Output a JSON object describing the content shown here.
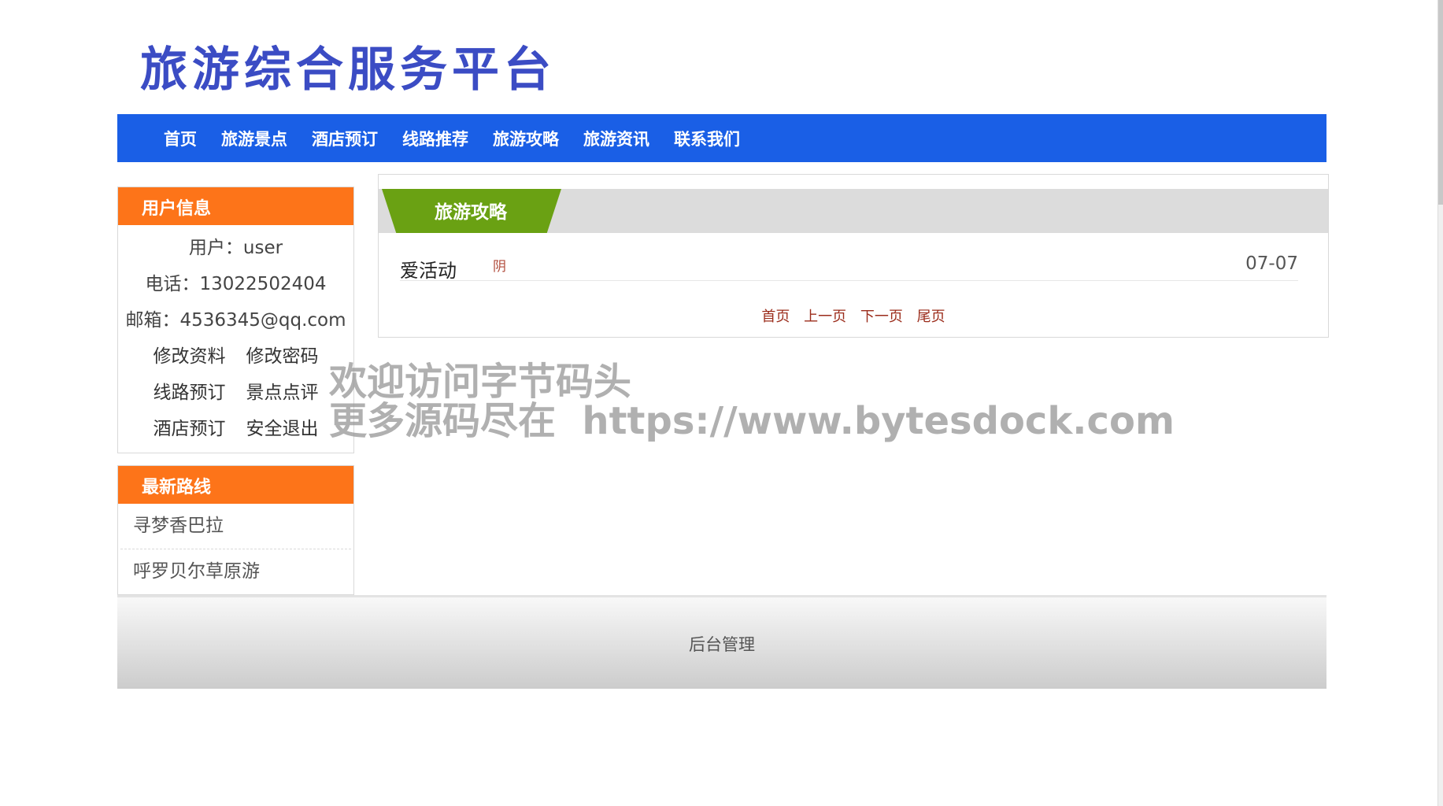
{
  "site": {
    "logo": "旅游综合服务平台"
  },
  "nav": [
    "首页",
    "旅游景点",
    "酒店预订",
    "线路推荐",
    "旅游攻略",
    "旅游资讯",
    "联系我们"
  ],
  "user_panel": {
    "title": "用户信息",
    "username": "用户：user",
    "phone": "电话：13022502404",
    "email": "邮箱：4536345@qq.com",
    "links": [
      "修改资料",
      "修改密码",
      "线路预订",
      "景点点评",
      "酒店预订",
      "安全退出"
    ]
  },
  "routes_panel": {
    "title": "最新路线",
    "items": [
      "寻梦香巴拉",
      "呼罗贝尔草原游"
    ]
  },
  "main": {
    "tab": "旅游攻略",
    "articles": [
      {
        "title": "爱活动",
        "tag": "阴",
        "date": "07-07"
      }
    ],
    "pager": [
      "首页",
      "上一页",
      "下一页",
      "尾页"
    ]
  },
  "watermark": {
    "line1": "欢迎访问字节码头",
    "line2": "更多源码尽在  https://www.bytesdock.com"
  },
  "footer": {
    "admin_link": "后台管理"
  }
}
